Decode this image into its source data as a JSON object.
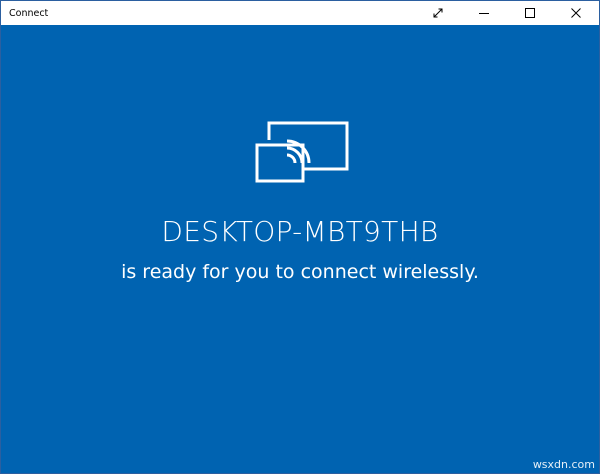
{
  "window": {
    "title": "Connect",
    "buttons": {
      "fullscreen": "expand-arrows-icon",
      "minimize": "minimize-icon",
      "maximize": "maximize-icon",
      "close": "close-icon"
    }
  },
  "main": {
    "icon": "screen-cast-icon",
    "device_name": "DESKTOP-MBT9THB",
    "status_text": "is ready for you to connect wirelessly."
  },
  "watermark": "wsxdn.com",
  "colors": {
    "background": "#0063b1",
    "text": "#ffffff",
    "titlebar": "#ffffff"
  }
}
